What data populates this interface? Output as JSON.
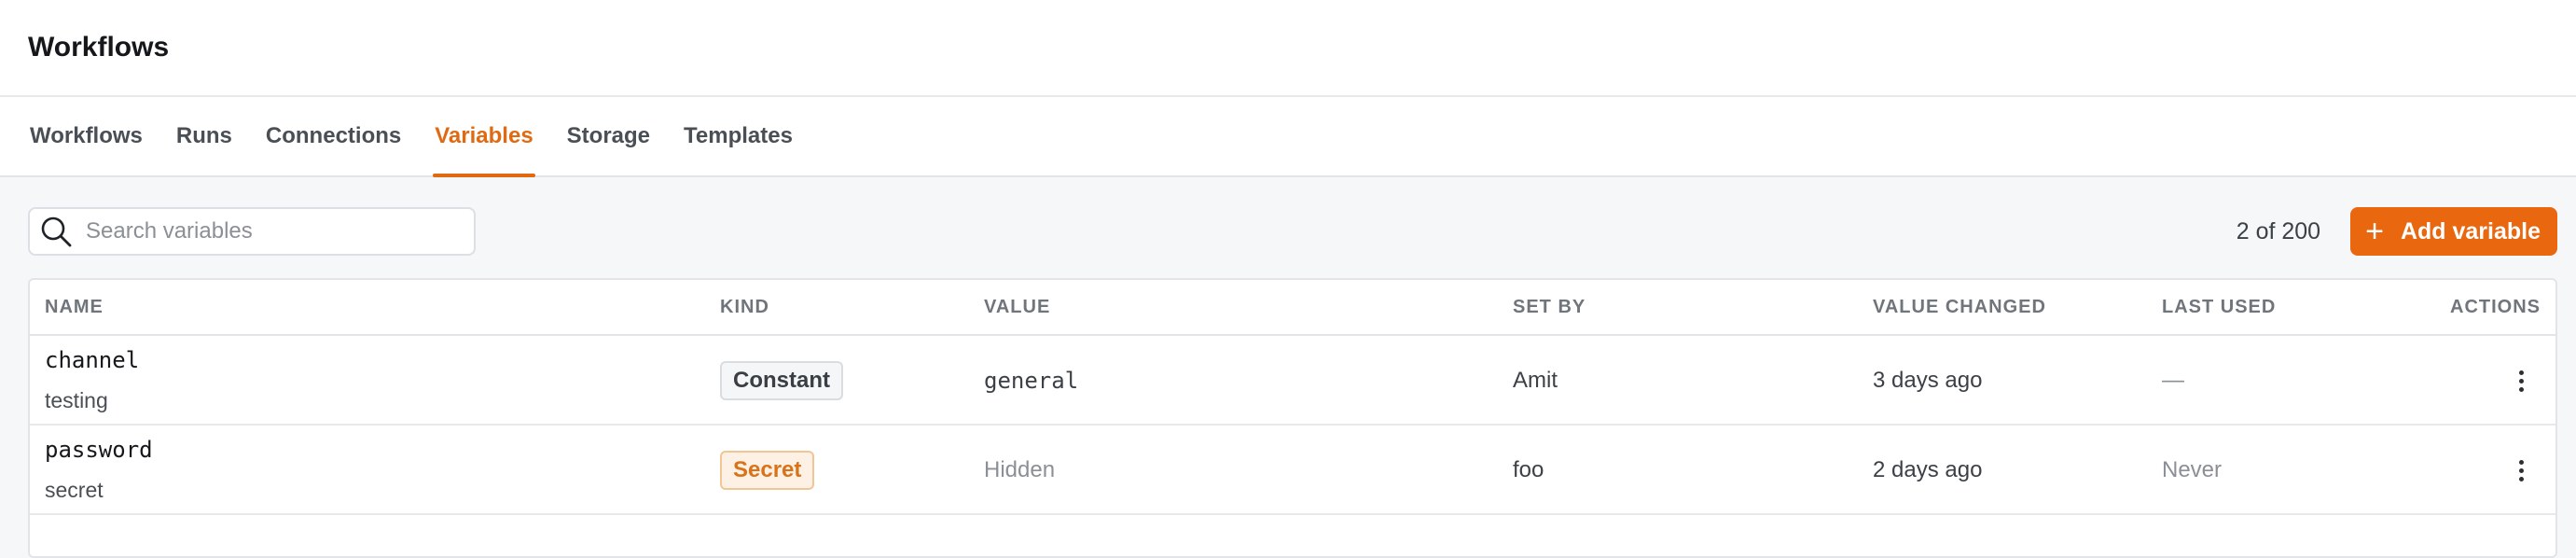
{
  "app": {
    "title": "Workflows"
  },
  "tabs": [
    {
      "label": "Workflows",
      "active": false
    },
    {
      "label": "Runs",
      "active": false
    },
    {
      "label": "Connections",
      "active": false
    },
    {
      "label": "Variables",
      "active": true
    },
    {
      "label": "Storage",
      "active": false
    },
    {
      "label": "Templates",
      "active": false
    }
  ],
  "toolbar": {
    "search_placeholder": "Search variables",
    "search_value": "",
    "count_text": "2 of 200",
    "add_label": "Add variable",
    "add_icon": "plus-icon",
    "search_icon": "search-icon"
  },
  "colors": {
    "accent": "#e9670f",
    "secret_badge_bg": "#fdf0e4",
    "secret_badge_text": "#d9731a"
  },
  "table": {
    "columns": {
      "name": "NAME",
      "kind": "KIND",
      "value": "VALUE",
      "set_by": "SET BY",
      "value_changed": "VALUE CHANGED",
      "last_used": "LAST USED",
      "actions": "ACTIONS"
    },
    "rows": [
      {
        "name": "channel",
        "description": "testing",
        "kind": "Constant",
        "value": "general",
        "set_by": "Amit",
        "value_changed": "3 days ago",
        "last_used": "—"
      },
      {
        "name": "password",
        "description": "secret",
        "kind": "Secret",
        "value": "Hidden",
        "set_by": "foo",
        "value_changed": "2 days ago",
        "last_used": "Never"
      }
    ]
  }
}
